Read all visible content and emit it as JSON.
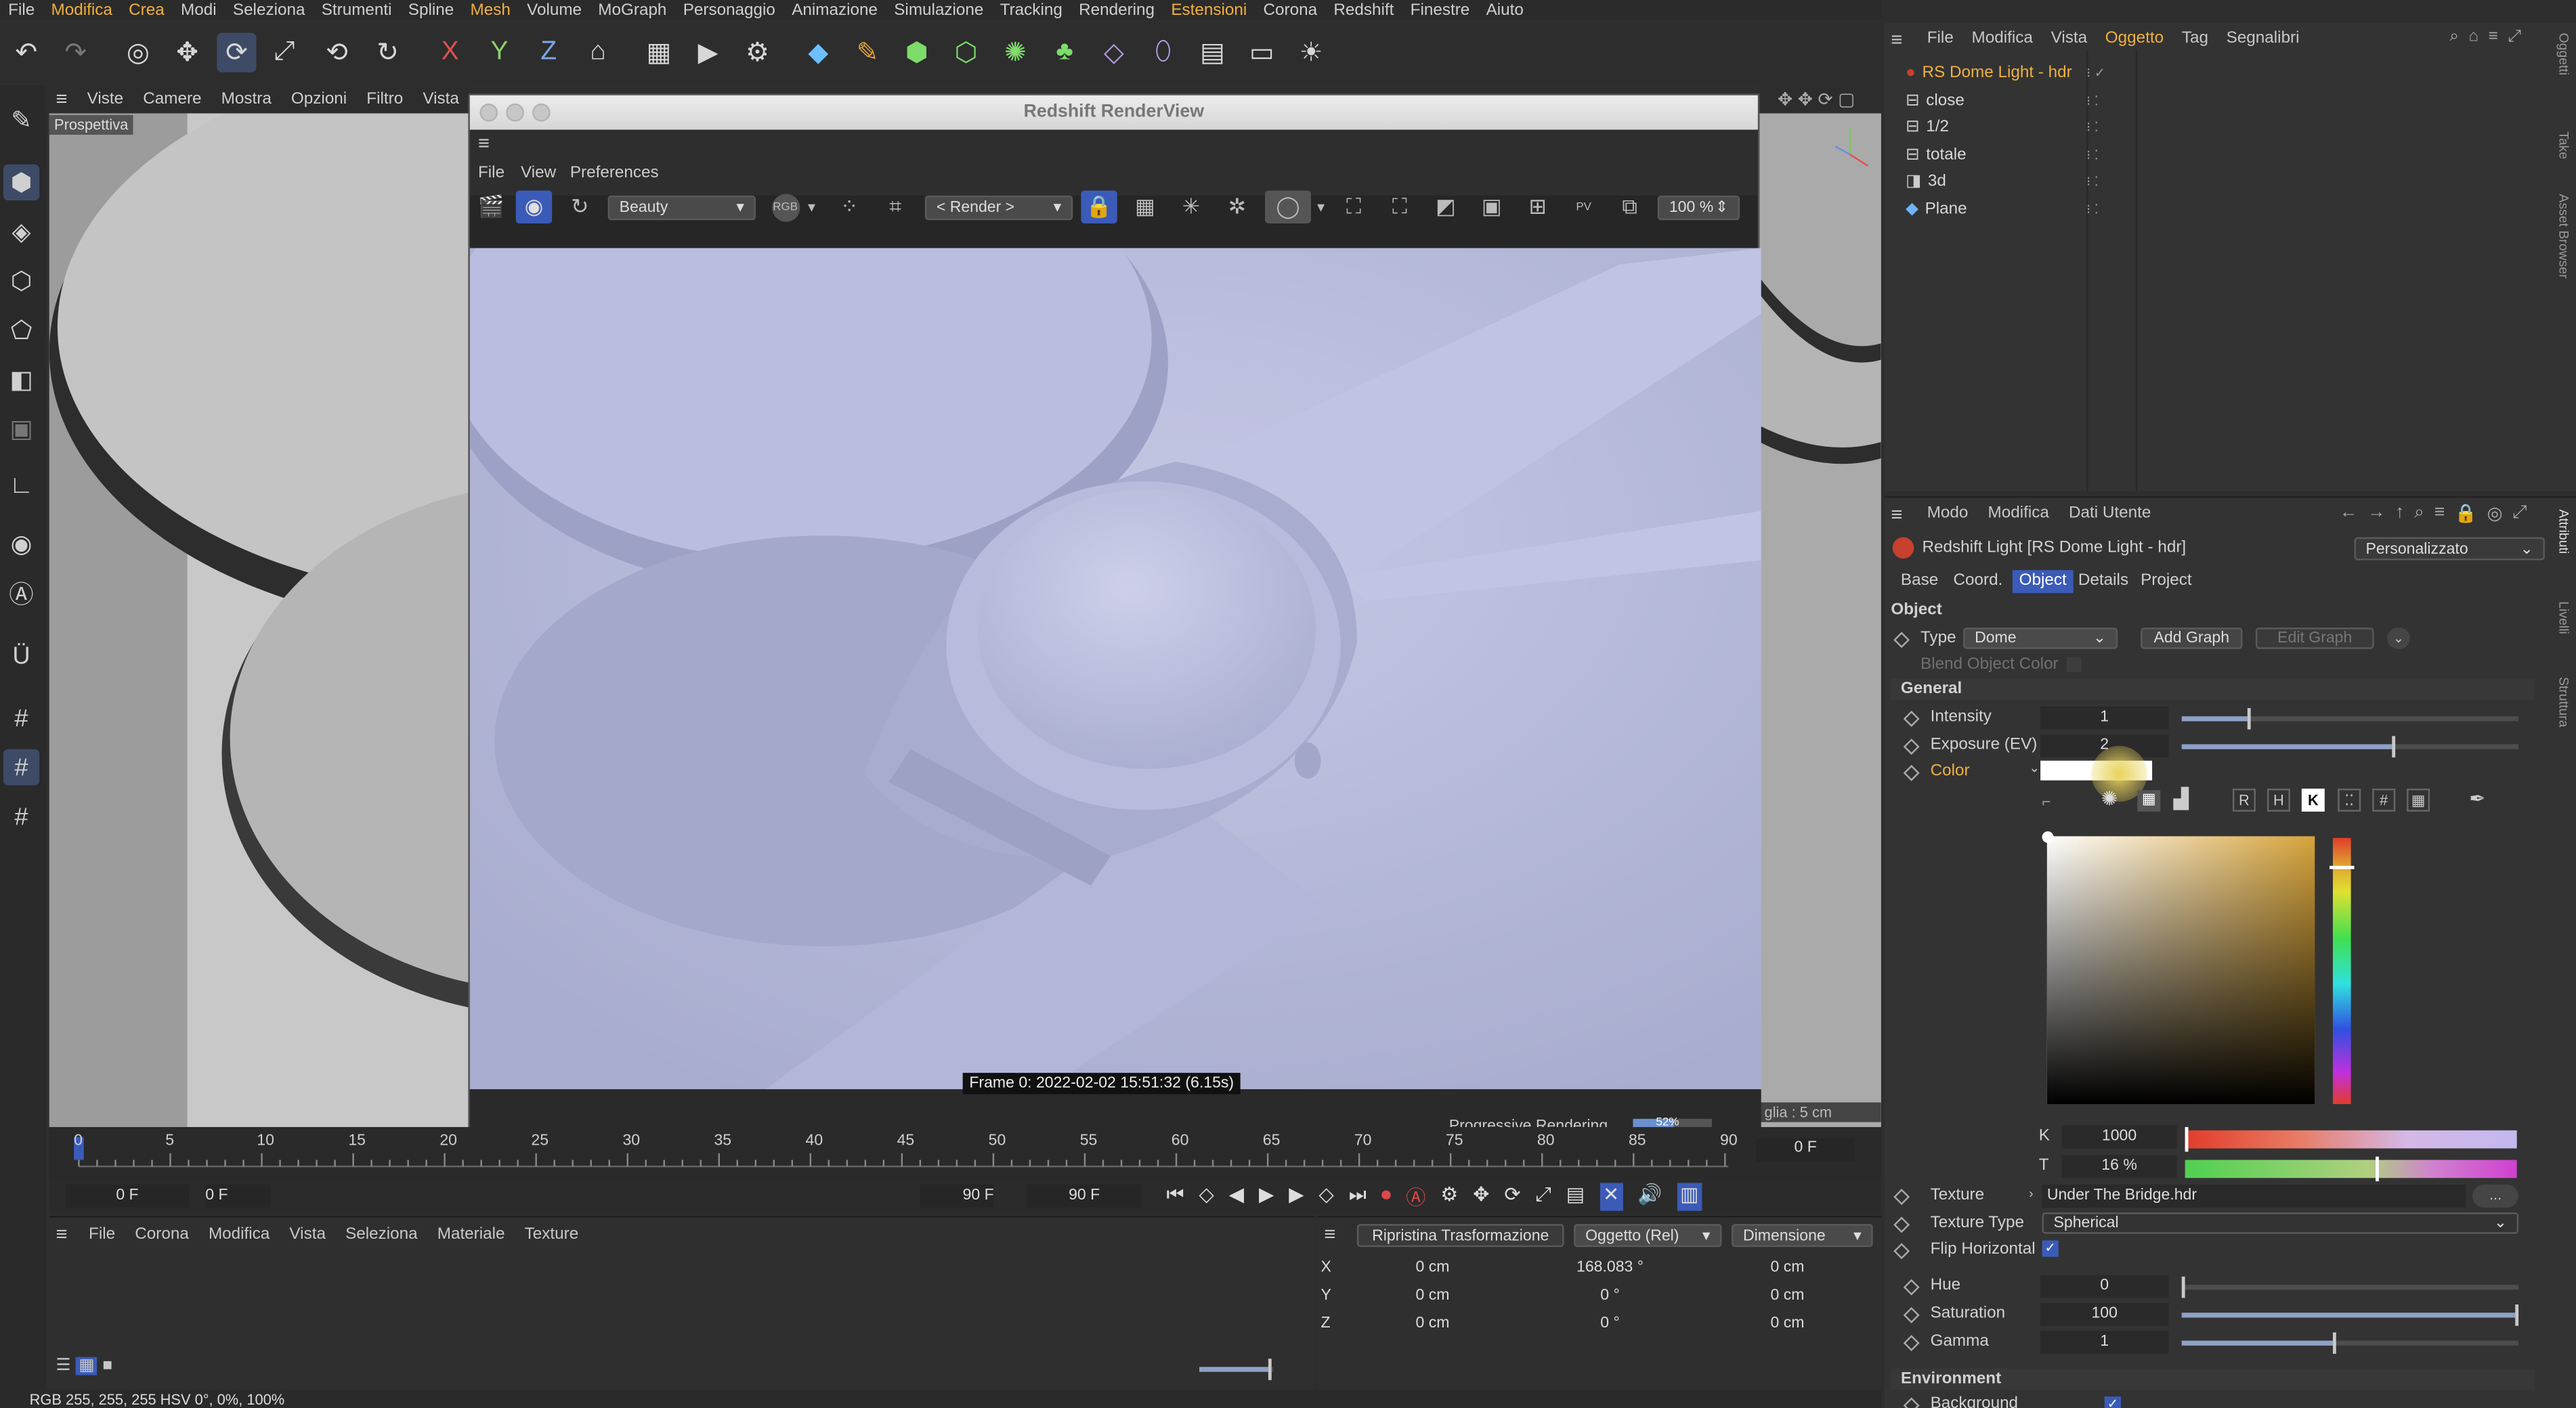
{
  "menubar": [
    "File",
    "Modifica",
    "Crea",
    "Modi",
    "Seleziona",
    "Strumenti",
    "Spline",
    "Mesh",
    "Volume",
    "MoGraph",
    "Personaggio",
    "Animazione",
    "Simulazione",
    "Tracking",
    "Rendering",
    "Estensioni",
    "Corona",
    "Redshift",
    "Finestre",
    "Aiuto"
  ],
  "viewport": {
    "menu": [
      "Viste",
      "Camere",
      "Mostra",
      "Opzioni",
      "Filtro",
      "Vista"
    ],
    "label": "Prospettiva",
    "grid_label": "glia : 5 cm"
  },
  "renderview": {
    "title": "Redshift RenderView",
    "menu": [
      "File",
      "View",
      "Preferences"
    ],
    "aov_select": "Beauty",
    "rgb_label": "RGB",
    "render_select": "< Render >",
    "zoom": "100 %",
    "frame_info": "Frame  0:  2022-02-02  15:51:32  (6.15s)",
    "progress_label": "Progressive Rendering...",
    "progress_pct": "52%",
    "progress": 0.52,
    "pv_label": "PV"
  },
  "timeline": {
    "ticks": [
      "0",
      "5",
      "10",
      "15",
      "20",
      "25",
      "30",
      "35",
      "40",
      "45",
      "50",
      "55",
      "60",
      "65",
      "70",
      "75",
      "80",
      "85",
      "90"
    ],
    "current_frame": "0 F",
    "start": "0 F",
    "start2": "0 F",
    "end": "90 F",
    "end2": "90 F"
  },
  "material_manager": {
    "menu": [
      "File",
      "Corona",
      "Modifica",
      "Vista",
      "Seleziona",
      "Materiale",
      "Texture"
    ]
  },
  "coords": {
    "reset": "Ripristina Trasformazione",
    "mode": "Oggetto (Rel)",
    "size_mode": "Dimensione",
    "rows": [
      {
        "axis": "X",
        "pos": "0 cm",
        "rot": "168.083 °",
        "size": "0 cm"
      },
      {
        "axis": "Y",
        "pos": "0 cm",
        "rot": "0 °",
        "size": "0 cm"
      },
      {
        "axis": "Z",
        "pos": "0 cm",
        "rot": "0 °",
        "size": "0 cm"
      }
    ]
  },
  "status": "RGB  255, 255, 255   HSV  0°, 0%, 100%",
  "object_manager": {
    "menu": [
      "File",
      "Modifica",
      "Vista",
      "Oggetto",
      "Tag",
      "Segnalibri"
    ],
    "objects": [
      "RS Dome Light - hdr",
      "close",
      "1/2",
      "totale",
      "3d",
      "Plane"
    ]
  },
  "attributes": {
    "menu": [
      "Modo",
      "Modifica",
      "Dati Utente"
    ],
    "object_title": "Redshift Light [RS Dome Light - hdr]",
    "preset": "Personalizzato",
    "tabs": [
      "Base",
      "Coord.",
      "Object",
      "Details",
      "Project"
    ],
    "section": "Object",
    "type_label": "Type",
    "type_value": "Dome",
    "add_graph": "Add Graph",
    "edit_graph": "Edit Graph",
    "blend_color": "Blend Object Color",
    "general": "General",
    "intensity_label": "Intensity",
    "intensity": "1",
    "exposure_label": "Exposure (EV)",
    "exposure": "2",
    "color_label": "Color",
    "color_mode_buttons": [
      "R",
      "H",
      "K",
      "#"
    ],
    "k_label": "K",
    "k_value": "1000",
    "t_label": "T",
    "t_value": "16 %",
    "texture_label": "Texture",
    "texture_value": "Under The Bridge.hdr",
    "texture_more": "...",
    "texture_type_label": "Texture Type",
    "texture_type": "Spherical",
    "flip_label": "Flip Horizontal",
    "hue_label": "Hue",
    "hue": "0",
    "saturation_label": "Saturation",
    "saturation": "100",
    "gamma_label": "Gamma",
    "gamma": "1",
    "environment": "Environment",
    "background_label": "Background"
  },
  "side_tabs": [
    "Oggetti",
    "Take",
    "Asset Browser",
    "Attributi",
    "Livelli",
    "Struttura"
  ],
  "colors": {
    "accent": "#3b5bb8",
    "highlight": "#f0b040",
    "render_bg": "#b4b8d8"
  }
}
